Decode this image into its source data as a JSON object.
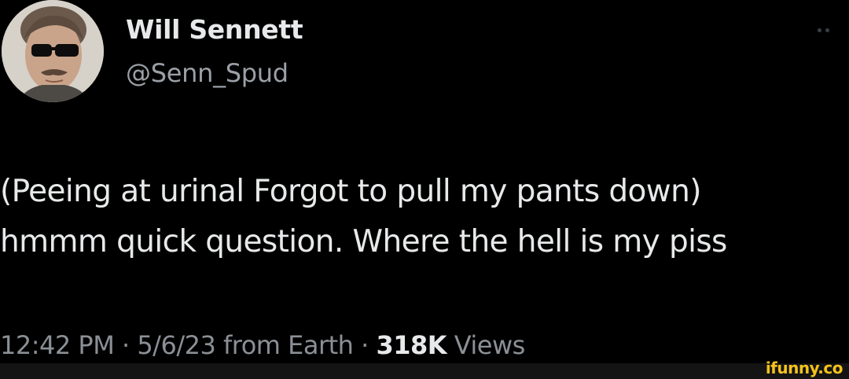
{
  "author": {
    "name": "Will Sennett",
    "handle": "@Senn_Spud",
    "avatar_icon": "user-avatar-photo"
  },
  "more_icon": "more-options-icon",
  "tweet": {
    "lines": [
      "(Peeing at urinal Forgot to pull my pants down)",
      "hmmm quick question. Where the hell is my piss"
    ]
  },
  "meta": {
    "time": "12:42 PM",
    "separator": "·",
    "date": "5/6/23",
    "source": "from Earth",
    "views_count": "318K",
    "views_label": "Views"
  },
  "watermark": {
    "text": "ifunny.co"
  },
  "colors": {
    "background": "#000000",
    "primary_text": "#e7e9ea",
    "secondary_text": "#9aa0a6",
    "watermark": "#f4c21b"
  }
}
